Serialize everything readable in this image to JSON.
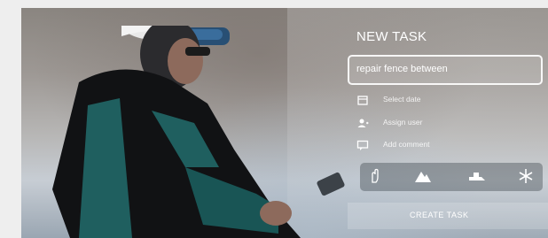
{
  "task_card": {
    "title": "NEW TASK",
    "input_value": "repair fence between",
    "actions": [
      {
        "label": "Select date",
        "icon": "calendar-icon"
      },
      {
        "label": "Assign user",
        "icon": "user-icon"
      },
      {
        "label": "Add comment",
        "icon": "comment-icon"
      }
    ],
    "toolbar_icons": [
      "hand-icon",
      "mountain-icon",
      "snow-groomer-icon",
      "snowflake-icon"
    ],
    "create_label": "CREATE TASK"
  }
}
